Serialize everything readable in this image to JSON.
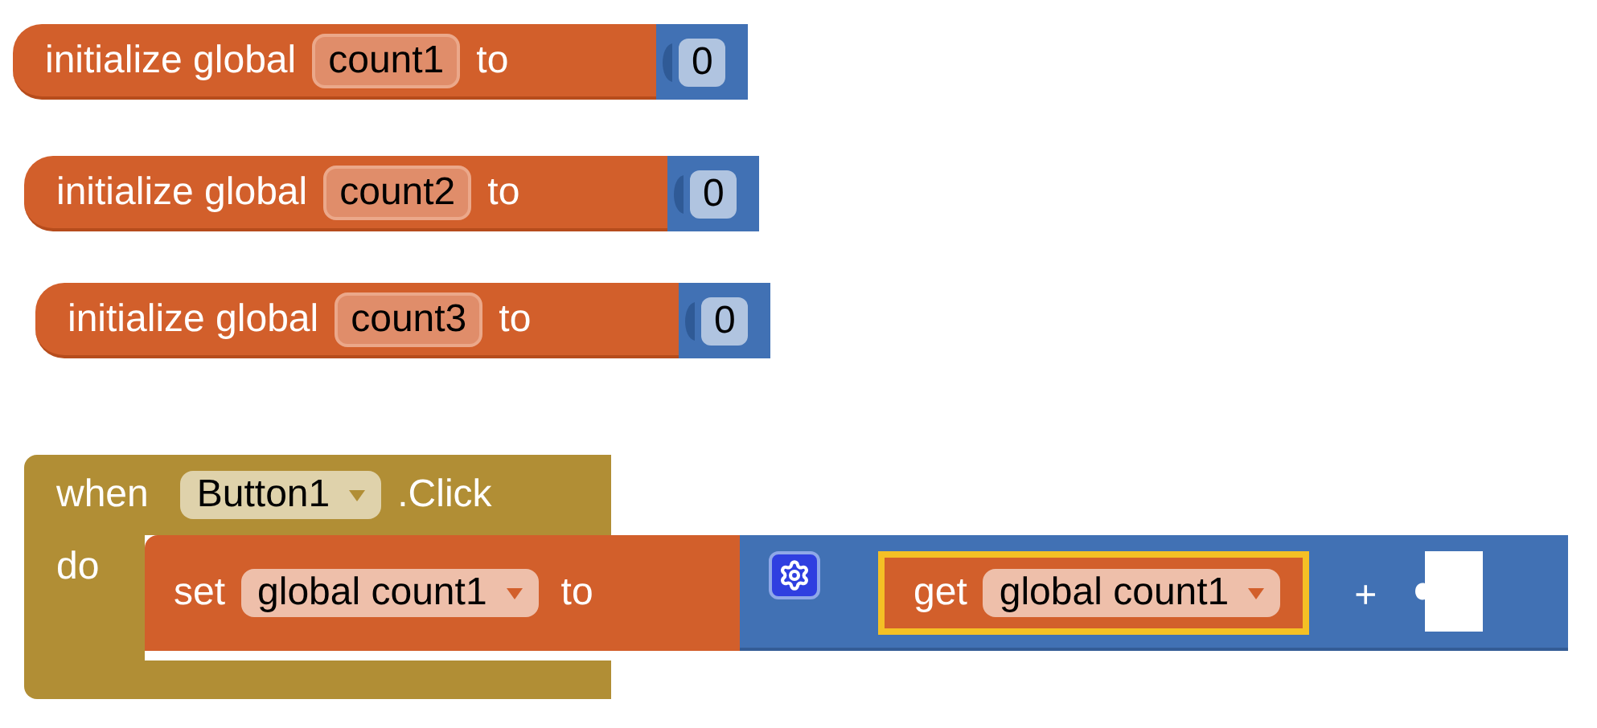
{
  "init_blocks": [
    {
      "keyword": "initialize global",
      "name": "count1",
      "to": "to",
      "value": "0"
    },
    {
      "keyword": "initialize global",
      "name": "count2",
      "to": "to",
      "value": "0"
    },
    {
      "keyword": "initialize global",
      "name": "count3",
      "to": "to",
      "value": "0"
    }
  ],
  "event_block": {
    "when": "when",
    "component": "Button1",
    "event": ".Click",
    "do": "do",
    "statement": {
      "keyword": "set",
      "variable": "global count1",
      "to": "to",
      "value": {
        "getter": {
          "keyword": "get",
          "variable": "global count1",
          "selected": true
        },
        "operator": "+"
      }
    }
  }
}
